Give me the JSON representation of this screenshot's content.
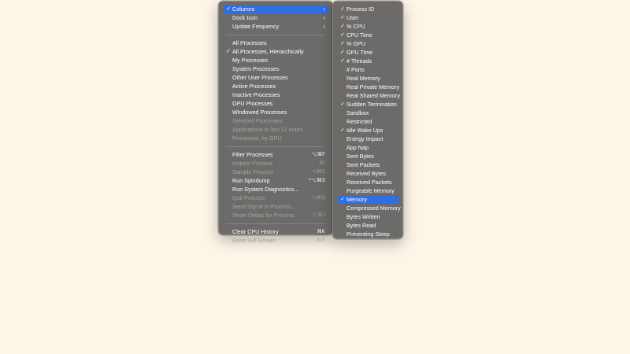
{
  "main_menu": {
    "top": [
      {
        "label": "Columns",
        "checked": true,
        "submenu": true,
        "highlighted": true
      },
      {
        "label": "Dock Icon",
        "checked": false,
        "submenu": true
      },
      {
        "label": "Update Frequency",
        "checked": false,
        "submenu": true
      }
    ],
    "views": [
      {
        "label": "All Processes",
        "checked": false,
        "enabled": true
      },
      {
        "label": "All Processes, Hierarchically",
        "checked": true,
        "enabled": true
      },
      {
        "label": "My Processes",
        "checked": false,
        "enabled": true
      },
      {
        "label": "System Processes",
        "checked": false,
        "enabled": true
      },
      {
        "label": "Other User Processes",
        "checked": false,
        "enabled": true
      },
      {
        "label": "Active Processes",
        "checked": false,
        "enabled": true
      },
      {
        "label": "Inactive Processes",
        "checked": false,
        "enabled": true
      },
      {
        "label": "GPU Processes",
        "checked": false,
        "enabled": true
      },
      {
        "label": "Windowed Processes",
        "checked": false,
        "enabled": true
      },
      {
        "label": "Selected Processes",
        "checked": false,
        "enabled": false
      },
      {
        "label": "Applications in last 12 hours",
        "checked": false,
        "enabled": false
      },
      {
        "label": "Processes, by GPU",
        "checked": false,
        "enabled": false
      }
    ],
    "actions": [
      {
        "label": "Filter Processes",
        "shortcut": "⌥⌘F",
        "enabled": true
      },
      {
        "label": "Inspect Process",
        "shortcut": "⌘I",
        "enabled": false
      },
      {
        "label": "Sample Process",
        "shortcut": "⌥⌘S",
        "enabled": false
      },
      {
        "label": "Run Spindump",
        "shortcut": "^⌥⌘S",
        "enabled": true
      },
      {
        "label": "Run System Diagnostics...",
        "shortcut": "",
        "enabled": true
      },
      {
        "label": "Quit Process",
        "shortcut": "⌥⌘Q",
        "enabled": false
      },
      {
        "label": "Send Signal to Process...",
        "shortcut": "",
        "enabled": false
      },
      {
        "label": "Show Deltas for Process",
        "shortcut": "⌥⌘J",
        "enabled": false
      }
    ],
    "bottom": [
      {
        "label": "Clear CPU History",
        "shortcut": "⌘K",
        "enabled": true
      },
      {
        "label": "Enter Full Screen",
        "shortcut": "fn F",
        "enabled": false
      }
    ]
  },
  "columns_submenu": [
    {
      "label": "Process ID",
      "checked": true
    },
    {
      "label": "User",
      "checked": true
    },
    {
      "label": "% CPU",
      "checked": true
    },
    {
      "label": "CPU Time",
      "checked": true
    },
    {
      "label": "% GPU",
      "checked": true
    },
    {
      "label": "GPU Time",
      "checked": true
    },
    {
      "label": "# Threads",
      "checked": true
    },
    {
      "label": "# Ports",
      "checked": false
    },
    {
      "label": "Real Memory",
      "checked": false
    },
    {
      "label": "Real Private Memory",
      "checked": false
    },
    {
      "label": "Real Shared Memory",
      "checked": false
    },
    {
      "label": "Sudden Termination",
      "checked": true
    },
    {
      "label": "Sandbox",
      "checked": false
    },
    {
      "label": "Restricted",
      "checked": false
    },
    {
      "label": "Idle Wake Ups",
      "checked": true
    },
    {
      "label": "Energy Impact",
      "checked": false
    },
    {
      "label": "App Nap",
      "checked": false
    },
    {
      "label": "Sent Bytes",
      "checked": false
    },
    {
      "label": "Sent Packets",
      "checked": false
    },
    {
      "label": "Received Bytes",
      "checked": false
    },
    {
      "label": "Received Packets",
      "checked": false
    },
    {
      "label": "Purgeable Memory",
      "checked": false
    },
    {
      "label": "Memory",
      "checked": true,
      "highlighted": true
    },
    {
      "label": "Compressed Memory",
      "checked": false
    },
    {
      "label": "Bytes Written",
      "checked": false
    },
    {
      "label": "Bytes Read",
      "checked": false
    },
    {
      "label": "Preventing Sleep",
      "checked": false
    }
  ],
  "glyphs": {
    "check": "✓",
    "submenu_arrow": "›"
  },
  "colors": {
    "background": "#fcf5e8",
    "menu": "#686664",
    "highlight": "#2f6fe0",
    "disabled_text": "#a5a3a0"
  }
}
